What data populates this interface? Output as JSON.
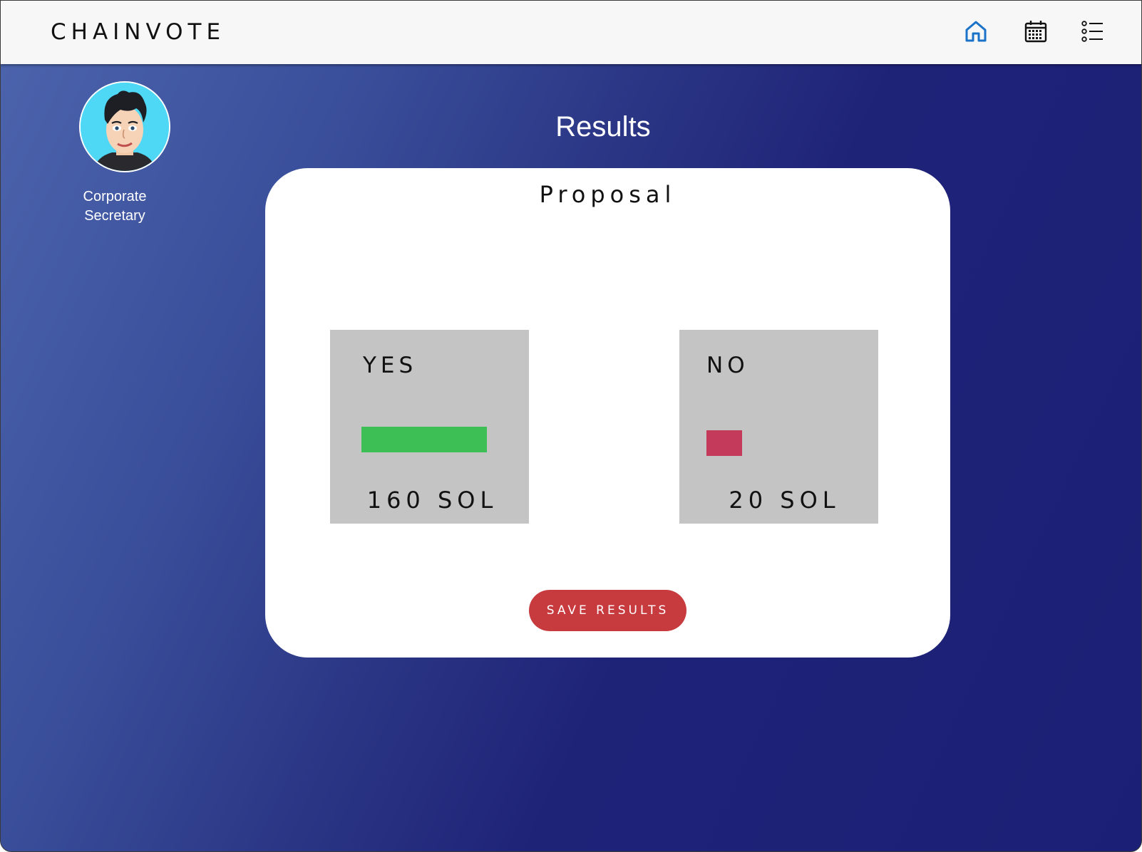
{
  "app": {
    "brand": "CHAINVOTE"
  },
  "nav": {
    "items": [
      {
        "icon": "home-icon",
        "active": true,
        "color": "#1a73c9"
      },
      {
        "icon": "calendar-icon",
        "active": false,
        "color": "#111111"
      },
      {
        "icon": "list-icon",
        "active": false,
        "color": "#111111"
      }
    ]
  },
  "profile": {
    "role": "Corporate Secretary"
  },
  "page": {
    "title": "Results"
  },
  "proposal": {
    "title": "Proposal",
    "options": [
      {
        "label": "YES",
        "amount": "160 SOL",
        "value": 160,
        "share": 0.889,
        "color": "#3dbf55"
      },
      {
        "label": "NO",
        "amount": "20 SOL",
        "value": 20,
        "share": 0.111,
        "color": "#c43a5b"
      }
    ]
  },
  "actions": {
    "save_label": "SAVE RESULTS"
  }
}
